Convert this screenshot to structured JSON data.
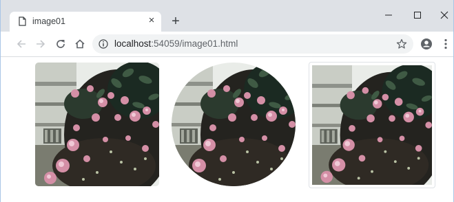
{
  "browser": {
    "tab": {
      "title": "image01",
      "close_glyph": "×",
      "icon": "page-icon"
    },
    "new_tab_glyph": "+",
    "window_controls": [
      "minimize-icon",
      "maximize-icon",
      "close-icon"
    ],
    "nav": [
      "back-arrow-icon",
      "forward-arrow-icon",
      "reload-icon",
      "home-icon"
    ],
    "address": {
      "host": "localhost",
      "rest": ":54059/image01.html"
    },
    "toolbar_right": [
      "star-icon",
      "account-icon",
      "menu-kebab-icon"
    ]
  },
  "page": {
    "images": [
      {
        "name": "rounded-image",
        "style": "rounded"
      },
      {
        "name": "circle-image",
        "style": "circle"
      },
      {
        "name": "thumbnail-image",
        "style": "thumbnail"
      }
    ]
  },
  "colors": {
    "tab_strip": "#dee1e6",
    "omnibox": "#f1f3f4",
    "icon": "#5f6368",
    "thumbnail_border": "#dee2e6"
  }
}
